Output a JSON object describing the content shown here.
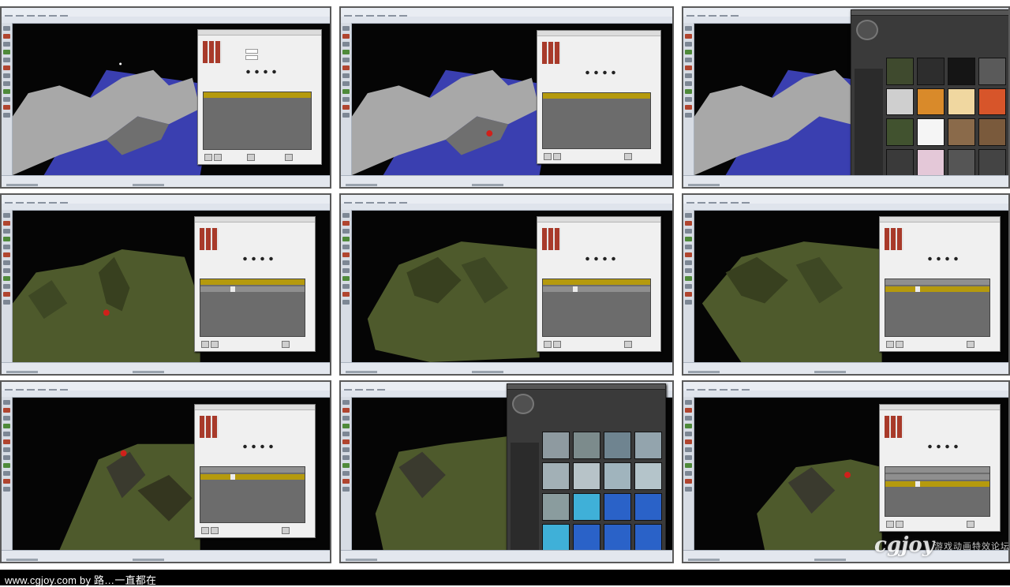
{
  "footer": {
    "credit": "www.cgjoy.com by 路…一直都在"
  },
  "watermark": {
    "logo": "cgjoy",
    "tagline": "游戏动画特效论坛"
  },
  "colors": {
    "water": "#3a3fb0",
    "rock": "#a8a8a8",
    "grass": "#4e5a2c",
    "layer_highlight": "#b59a0d",
    "selection_marker": "#d0201a"
  },
  "icons": [
    "toolbar-icon",
    "unreal-logo-icon",
    "selection-marker-icon"
  ]
}
